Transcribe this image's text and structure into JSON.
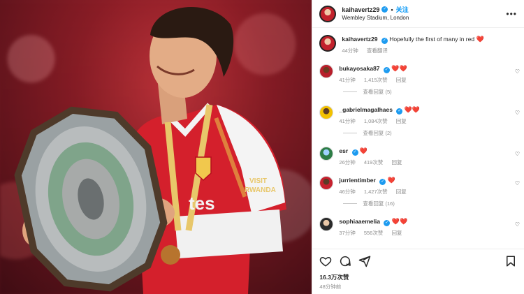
{
  "post": {
    "username": "kaihavertz29",
    "follow_label": "关注",
    "location": "Wembley Stadium, London",
    "more_icon": "more-horizontal-icon",
    "caption_user": "kaihavertz29",
    "caption_text": "Hopefully the first of many in red",
    "caption_time": "44分钟",
    "caption_translate": "查看翻译",
    "likes": "16.3万次赞",
    "time_ago": "48分钟前"
  },
  "comments": [
    {
      "user": "bukayosaka87",
      "verified": true,
      "text": "❤️❤️",
      "time": "41分钟",
      "likes": "1,415次赞",
      "reply": "回复",
      "replies": "查看回复 (5)"
    },
    {
      "user": "_gabrielmagalhaes",
      "verified": true,
      "text": "❤️❤️",
      "time": "41分钟",
      "likes": "1,084次赞",
      "reply": "回复",
      "replies": "查看回复 (2)"
    },
    {
      "user": "esr",
      "verified": true,
      "text": "❤️",
      "time": "26分钟",
      "likes": "419次赞",
      "reply": "回复",
      "replies": ""
    },
    {
      "user": "jurrientimber",
      "verified": true,
      "text": "❤️",
      "time": "46分钟",
      "likes": "1,427次赞",
      "reply": "回复",
      "replies": "查看回复 (16)"
    },
    {
      "user": "sophiaaemelia",
      "verified": true,
      "text": "❤️❤️",
      "time": "37分钟",
      "likes": "556次赞",
      "reply": "回复",
      "replies": ""
    }
  ],
  "colors": {
    "accent": "#0095f6",
    "heart": "#ed4956",
    "verified": "#1d9bf0",
    "muted": "#8e8e8e"
  },
  "icons": [
    "heart-outline-icon",
    "comment-icon",
    "share-icon",
    "bookmark-icon",
    "verified-badge-icon"
  ]
}
